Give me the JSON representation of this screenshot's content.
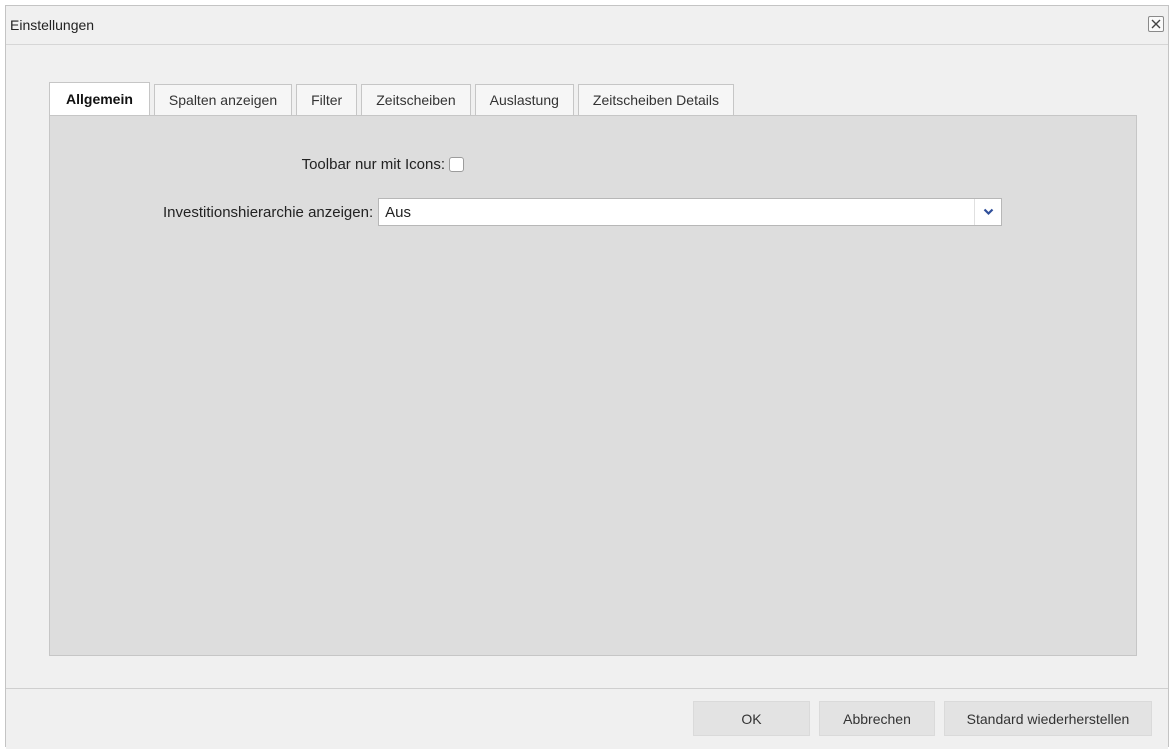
{
  "dialog": {
    "title": "Einstellungen",
    "close_icon": "close-icon"
  },
  "tabs": [
    {
      "label": "Allgemein",
      "active": true
    },
    {
      "label": "Spalten anzeigen",
      "active": false
    },
    {
      "label": "Filter",
      "active": false
    },
    {
      "label": "Zeitscheiben",
      "active": false
    },
    {
      "label": "Auslastung",
      "active": false
    },
    {
      "label": "Zeitscheiben Details",
      "active": false
    }
  ],
  "form": {
    "toolbar_icons": {
      "label": "Toolbar nur mit Icons:",
      "checked": false
    },
    "investment_hierarchy": {
      "label": "Investitionshierarchie anzeigen:",
      "value": "Aus",
      "trigger_icon": "chevron-down-icon"
    }
  },
  "footer": {
    "ok_label": "OK",
    "cancel_label": "Abbrechen",
    "reset_label": "Standard wiederherstellen"
  },
  "colors": {
    "panel_bg": "#dddddd",
    "dialog_bg": "#f0f0f0",
    "button_bg": "#e3e3e3",
    "chevron": "#2f4f9a"
  }
}
